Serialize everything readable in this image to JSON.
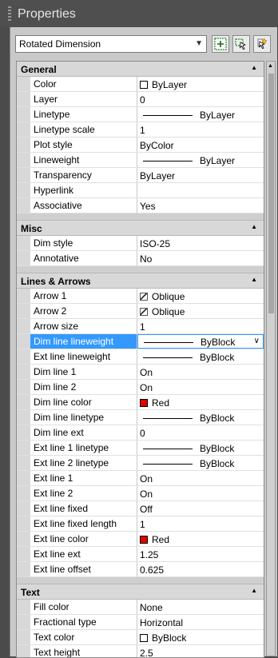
{
  "title": "Properties",
  "object_type": "Rotated Dimension",
  "sections": [
    {
      "title": "General",
      "rows": [
        {
          "name": "Color",
          "value": "ByLayer",
          "kind": "color",
          "color": "#ffffff"
        },
        {
          "name": "Layer",
          "value": "0"
        },
        {
          "name": "Linetype",
          "value": "ByLayer",
          "kind": "line"
        },
        {
          "name": "Linetype scale",
          "value": "1"
        },
        {
          "name": "Plot style",
          "value": "ByColor"
        },
        {
          "name": "Lineweight",
          "value": "ByLayer",
          "kind": "line"
        },
        {
          "name": "Transparency",
          "value": "ByLayer"
        },
        {
          "name": "Hyperlink",
          "value": ""
        },
        {
          "name": "Associative",
          "value": "Yes"
        }
      ]
    },
    {
      "title": "Misc",
      "rows": [
        {
          "name": "Dim style",
          "value": "ISO-25"
        },
        {
          "name": "Annotative",
          "value": "No"
        }
      ]
    },
    {
      "title": "Lines & Arrows",
      "rows": [
        {
          "name": "Arrow 1",
          "value": "Oblique",
          "kind": "arrow"
        },
        {
          "name": "Arrow 2",
          "value": "Oblique",
          "kind": "arrow"
        },
        {
          "name": "Arrow size",
          "value": "1"
        },
        {
          "name": "Dim line lineweight",
          "value": "ByBlock",
          "kind": "line",
          "selected": true
        },
        {
          "name": "Ext line lineweight",
          "value": "ByBlock",
          "kind": "line"
        },
        {
          "name": "Dim line 1",
          "value": "On"
        },
        {
          "name": "Dim line 2",
          "value": "On"
        },
        {
          "name": "Dim line color",
          "value": "Red",
          "kind": "color",
          "color": "#e00000"
        },
        {
          "name": "Dim line linetype",
          "value": "ByBlock",
          "kind": "line"
        },
        {
          "name": "Dim line ext",
          "value": "0"
        },
        {
          "name": "Ext line 1 linetype",
          "value": "ByBlock",
          "kind": "line"
        },
        {
          "name": "Ext line 2 linetype",
          "value": "ByBlock",
          "kind": "line"
        },
        {
          "name": "Ext line 1",
          "value": "On"
        },
        {
          "name": "Ext line 2",
          "value": "On"
        },
        {
          "name": "Ext line fixed",
          "value": "Off"
        },
        {
          "name": "Ext line fixed length",
          "value": "1"
        },
        {
          "name": "Ext line color",
          "value": "Red",
          "kind": "color",
          "color": "#e00000"
        },
        {
          "name": "Ext line ext",
          "value": "1.25"
        },
        {
          "name": "Ext line offset",
          "value": "0.625"
        }
      ]
    },
    {
      "title": "Text",
      "rows": [
        {
          "name": "Fill color",
          "value": "None"
        },
        {
          "name": "Fractional type",
          "value": "Horizontal"
        },
        {
          "name": "Text color",
          "value": "ByBlock",
          "kind": "color",
          "color": "#ffffff"
        },
        {
          "name": "Text height",
          "value": "2.5"
        }
      ]
    }
  ],
  "colors": {
    "selection": "#3399ff",
    "red": "#e00000"
  }
}
